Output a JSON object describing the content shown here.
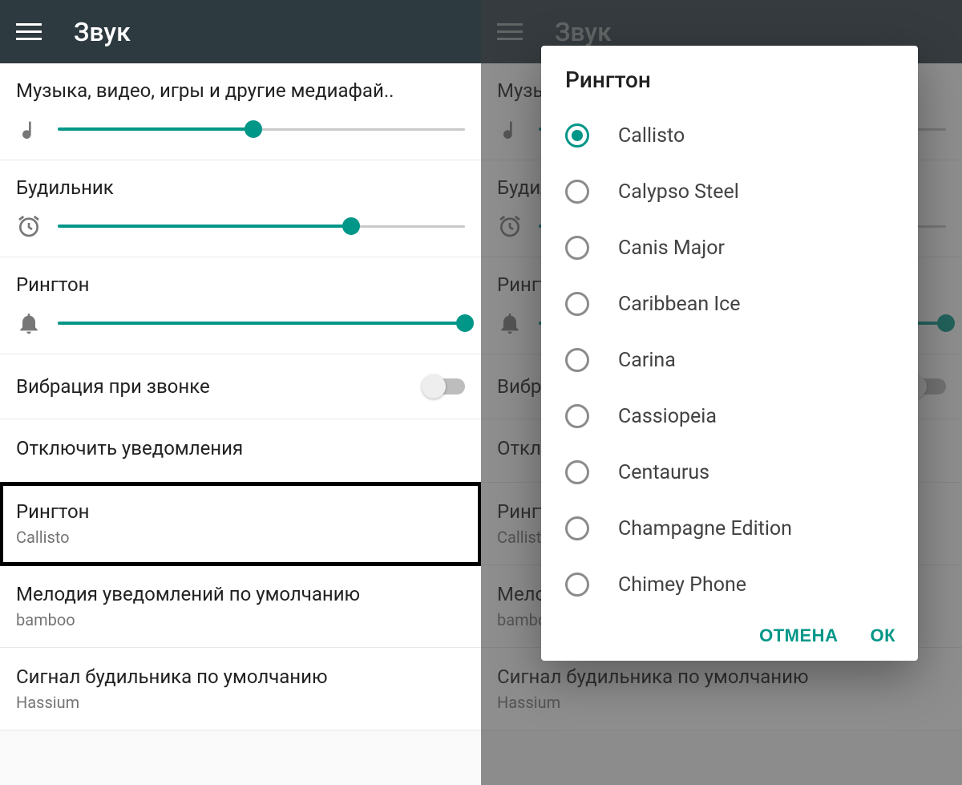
{
  "colors": {
    "accent": "#009688",
    "appbar": "#2d3a40"
  },
  "left": {
    "title": "Звук",
    "sliders": {
      "media": {
        "label": "Музыка, видео, игры и другие медиафай..",
        "percent": 48
      },
      "alarm": {
        "label": "Будильник",
        "percent": 72
      },
      "ringtone": {
        "label": "Рингтон",
        "percent": 100
      }
    },
    "vibrate": {
      "label": "Вибрация при звонке",
      "on": false
    },
    "mute_notifications": {
      "label": "Отключить уведомления"
    },
    "rows": {
      "ringtone": {
        "title": "Рингтон",
        "value": "Callisto"
      },
      "notification": {
        "title": "Мелодия уведомлений по умолчанию",
        "value": "bamboo"
      },
      "alarm": {
        "title": "Сигнал будильника по умолчанию",
        "value": "Hassium"
      }
    }
  },
  "right": {
    "title": "Звук",
    "dialog": {
      "title": "Рингтон",
      "selectedIndex": 0,
      "options": [
        "Callisto",
        "Calypso Steel",
        "Canis Major",
        "Caribbean Ice",
        "Carina",
        "Cassiopeia",
        "Centaurus",
        "Champagne Edition",
        "Chimey Phone"
      ],
      "cancel": "ОТМЕНА",
      "ok": "ОК"
    }
  }
}
